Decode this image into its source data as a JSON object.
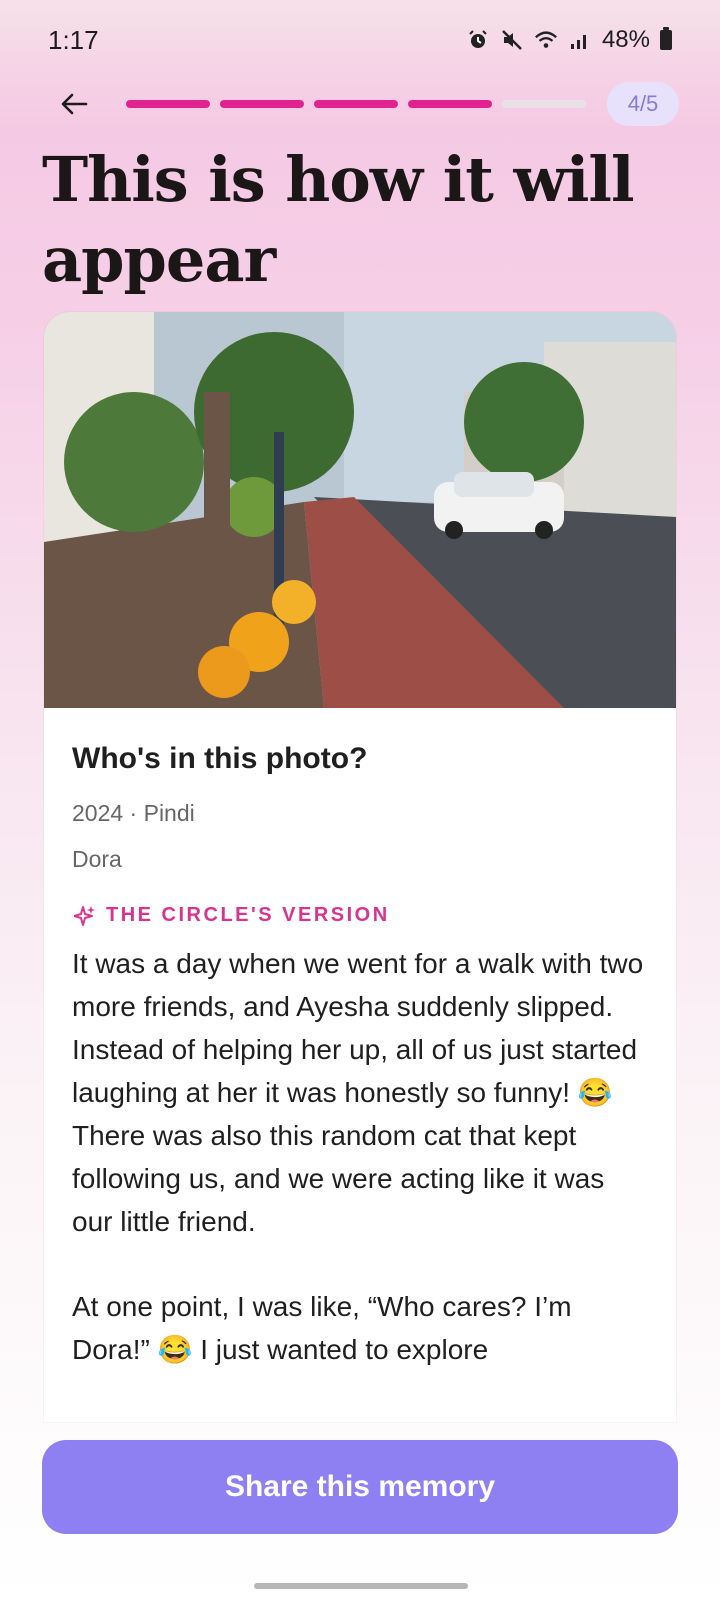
{
  "status_bar": {
    "time": "1:17",
    "battery_percent": "48%",
    "icons": [
      "alarm-icon",
      "mute-icon",
      "wifi-icon",
      "signal-icon",
      "battery-icon"
    ]
  },
  "header": {
    "progress": {
      "current": 4,
      "total": 5
    },
    "step_label": "4/5"
  },
  "page": {
    "title": "This is how it will appear"
  },
  "card": {
    "question": "Who's in this photo?",
    "meta": "2024 · Pindi",
    "person": "Dora",
    "version_label": "THE CIRCLE'S VERSION",
    "story_paragraphs": [
      "It was a day when we went for a walk with two more friends, and Ayesha suddenly slipped. Instead of helping her up, all of us just started laughing at her it was honestly so funny! 😂 There was also this random cat that kept following us, and we were acting like it was our little friend.",
      "At one point, I was like, “Who cares? I’m Dora!” 😂 I just wanted to explore"
    ]
  },
  "actions": {
    "share_label": "Share this memory"
  },
  "colors": {
    "accent_pink": "#e2238f",
    "button_purple": "#8e80f2",
    "badge_bg": "#e8e1fb"
  }
}
